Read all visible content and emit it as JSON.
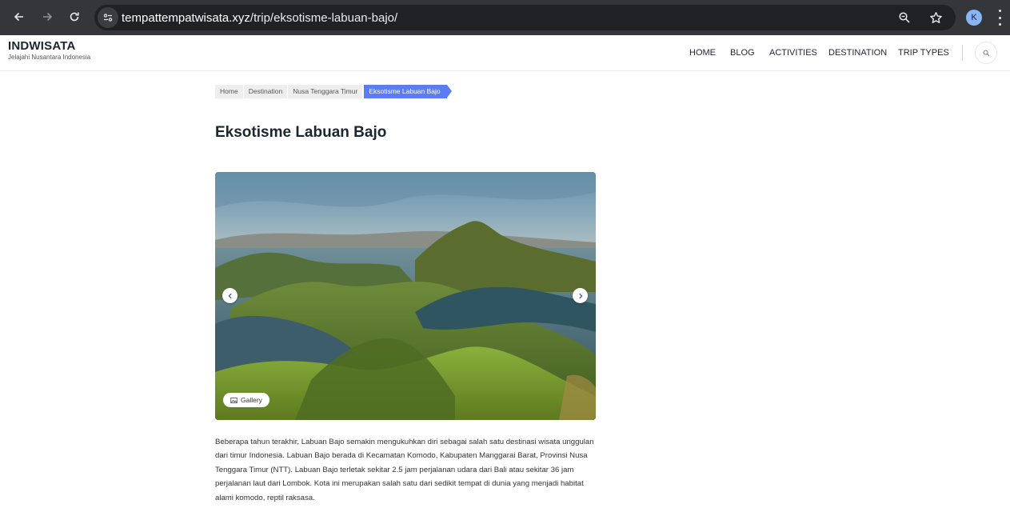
{
  "browser": {
    "url_host": "tempattempatwisata.xyz",
    "url_path": "/trip/eksotisme-labuan-bajo/",
    "profile_initial": "K"
  },
  "site": {
    "brand": "INDWISATA",
    "tagline": "Jelajahi Nusantara Indonesia",
    "menu": [
      "HOME",
      "BLOG",
      "ACTIVITIES",
      "DESTINATION",
      "TRIP TYPES"
    ]
  },
  "breadcrumb": [
    "Home",
    "Destination",
    "Nusa Tenggara Timur",
    "Eksotisme Labuan Bajo"
  ],
  "page": {
    "title": "Eksotisme Labuan Bajo",
    "gallery_label": "Gallery",
    "description": "Beberapa tahun terakhir, Labuan Bajo semakin mengukuhkan diri sebagai salah satu destinasi wisata unggulan dari timur Indonesia. Labuan Bajo berada di Kecamatan Komodo, Kabupaten Manggarai Barat, Provinsi Nusa Tenggara Timur (NTT). Labuan Bajo terletak sekitar 2.5 jam perjalanan udara dari Bali atau sekitar 36 jam perjalanan laut dari Lombok. Kota ini merupakan salah satu dari sedikit tempat di dunia yang menjadi habitat alami komodo, reptil raksasa."
  },
  "colors": {
    "chrome": "#35363a",
    "omnibox": "#202124",
    "accent": "#5b7cf2",
    "text": "#1d2630"
  },
  "icons": [
    "back-icon",
    "forward-icon",
    "reload-icon",
    "site-info-icon",
    "zoom-icon",
    "bookmark-star-icon",
    "kebab-menu-icon",
    "search-icon",
    "chevron-left-icon",
    "chevron-right-icon",
    "gallery-icon"
  ]
}
